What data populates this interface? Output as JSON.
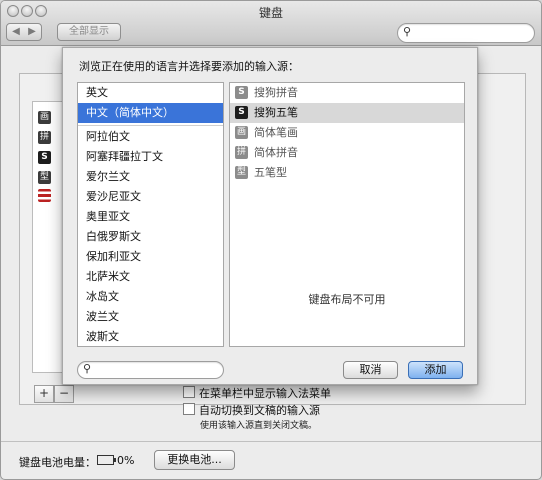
{
  "window": {
    "title": "键盘",
    "toolbar": {
      "show_all_label": "全部显示",
      "back_icon": "◀",
      "forward_icon": "▶"
    }
  },
  "sheet": {
    "title": "浏览正在使用的语言并选择要添加的输入源：",
    "languages": [
      {
        "label": "英文"
      },
      {
        "label": "中文（简体中文）"
      },
      {
        "label": "阿拉伯文"
      },
      {
        "label": "阿塞拜疆拉丁文"
      },
      {
        "label": "爱尔兰文"
      },
      {
        "label": "爱沙尼亚文"
      },
      {
        "label": "奥里亚文"
      },
      {
        "label": "白俄罗斯文"
      },
      {
        "label": "保加利亚文"
      },
      {
        "label": "北萨米文"
      },
      {
        "label": "冰岛文"
      },
      {
        "label": "波兰文"
      },
      {
        "label": "波斯文"
      }
    ],
    "selected_language": "中文（简体中文）",
    "input_sources": [
      {
        "label": "搜狗拼音",
        "icon": "S"
      },
      {
        "label": "搜狗五笔",
        "icon": "S"
      },
      {
        "label": "简体笔画",
        "icon": "画"
      },
      {
        "label": "简体拼音",
        "icon": "拼"
      },
      {
        "label": "五笔型",
        "icon": "型"
      }
    ],
    "selected_input_source": "搜狗五笔",
    "layout_unavailable": "键盘布局不可用",
    "cancel_label": "取消",
    "add_label": "添加"
  },
  "background": {
    "checkbox_1_label": "在菜单栏中显示输入法菜单",
    "checkbox_2_label": "自动切换到文稿的输入源",
    "note": "使用该输入源直到关闭文稿。",
    "side_icons": [
      {
        "glyph": "画"
      },
      {
        "glyph": "拼"
      },
      {
        "glyph": "S"
      },
      {
        "glyph": "型"
      },
      {
        "glyph": ""
      }
    ],
    "add_symbol": "+",
    "remove_symbol": "−"
  },
  "battery": {
    "label": "键盘电池电量：",
    "value": "0%",
    "change_button": "更换电池..."
  },
  "colors": {
    "selection_blue": "#3a74d9",
    "selection_gray": "#d8d8d8",
    "icon_dark": "#3b3b3b",
    "icon_light": "#8c8c8c"
  }
}
